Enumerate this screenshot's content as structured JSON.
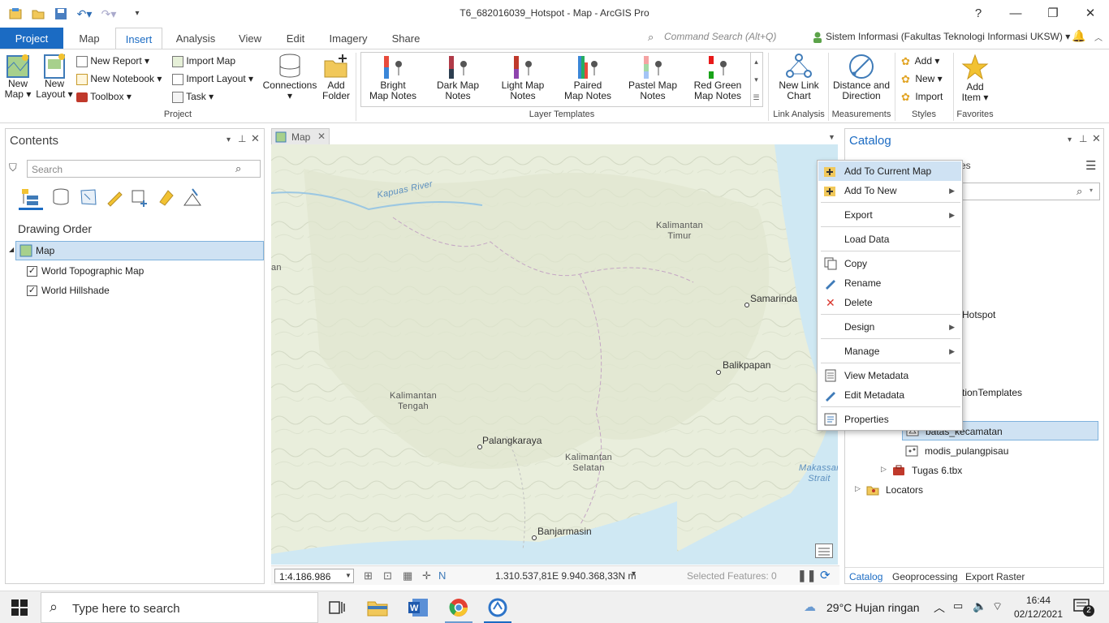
{
  "window": {
    "title": "T6_682016039_Hotspot - Map - ArcGIS Pro",
    "help_label": "?",
    "minimize_label": "—",
    "restore_label": "❐",
    "close_label": "✕"
  },
  "tabs": {
    "items": [
      "Project",
      "Map",
      "Insert",
      "Analysis",
      "View",
      "Edit",
      "Imagery",
      "Share"
    ],
    "active": "Insert"
  },
  "command_search": {
    "placeholder": "Command Search (Alt+Q)"
  },
  "signin": {
    "label": "Sistem Informasi (Fakultas Teknologi Informasi UKSW) ▾"
  },
  "ribbon": {
    "project": {
      "new_map_line1": "New",
      "new_map_line2": "Map ▾",
      "new_layout_line1": "New",
      "new_layout_line2": "Layout ▾",
      "new_report": "New Report ▾",
      "new_notebook": "New Notebook ▾",
      "toolbox": "Toolbox ▾",
      "import_map": "Import Map",
      "import_layout": "Import Layout ▾",
      "task": "Task ▾",
      "connections": "Connections",
      "add_folder_line1": "Add",
      "add_folder_line2": "Folder",
      "group": "Project"
    },
    "layer_templates": {
      "items": [
        {
          "line1": "Bright",
          "line2": "Map Notes"
        },
        {
          "line1": "Dark Map",
          "line2": "Notes"
        },
        {
          "line1": "Light Map",
          "line2": "Notes"
        },
        {
          "line1": "Paired",
          "line2": "Map Notes"
        },
        {
          "line1": "Pastel Map",
          "line2": "Notes"
        },
        {
          "line1": "Red Green",
          "line2": "Map Notes"
        }
      ],
      "group": "Layer Templates"
    },
    "link_analysis": {
      "line1": "New Link",
      "line2": "Chart",
      "group": "Link Analysis"
    },
    "measurements": {
      "line1": "Distance and",
      "line2": "Direction",
      "group": "Measurements"
    },
    "styles": {
      "add": "Add ▾",
      "new": "New ▾",
      "import": "Import",
      "group": "Styles"
    },
    "favorites": {
      "line1": "Add",
      "line2": "Item ▾",
      "group": "Favorites"
    }
  },
  "contents": {
    "title": "Contents",
    "search_placeholder": "Search",
    "drawing_order": "Drawing Order",
    "map_name": "Map",
    "layers": [
      "World Topographic Map",
      "World Hillshade"
    ]
  },
  "map_view": {
    "tab_label": "Map",
    "labels": {
      "river": "Kapuas River",
      "kaltim_1": "Kalimantan",
      "kaltim_2": "Timur",
      "kalteng_1": "Kalimantan",
      "kalteng_2": "Tengah",
      "kalsel_1": "Kalimantan",
      "kalsel_2": "Selatan",
      "strait_1": "Makassar",
      "strait_2": "Strait",
      "edge": "an"
    },
    "cities": [
      "Samarinda",
      "Balikpapan",
      "Palangkaraya",
      "Banjarmasin"
    ],
    "scale": "1:4.186.986",
    "coordinates": "1.310.537,81E 9.940.368,33N m",
    "selected_features": "Selected Features: 0"
  },
  "catalog": {
    "title": "Catalog",
    "partial_header": "es",
    "partial_items": [
      "Hotspot",
      "tionTemplates"
    ],
    "tree": {
      "batas": "batas_kecamatan",
      "modis": "modis_pulangpisau",
      "tugas": "Tugas 6.tbx",
      "locators": "Locators"
    },
    "bottom_tabs": [
      "Catalog",
      "Geoprocessing",
      "Export Raster"
    ]
  },
  "context_menu": {
    "add_to_current_map": "Add To Current Map",
    "add_to_new": "Add To New",
    "export": "Export",
    "load_data": "Load Data",
    "copy": "Copy",
    "rename": "Rename",
    "delete": "Delete",
    "design": "Design",
    "manage": "Manage",
    "view_metadata": "View Metadata",
    "edit_metadata": "Edit Metadata",
    "properties": "Properties"
  },
  "taskbar": {
    "search_placeholder": "Type here to search",
    "weather": "29°C  Hujan ringan",
    "time": "16:44",
    "date": "02/12/2021",
    "notifications": "2"
  }
}
